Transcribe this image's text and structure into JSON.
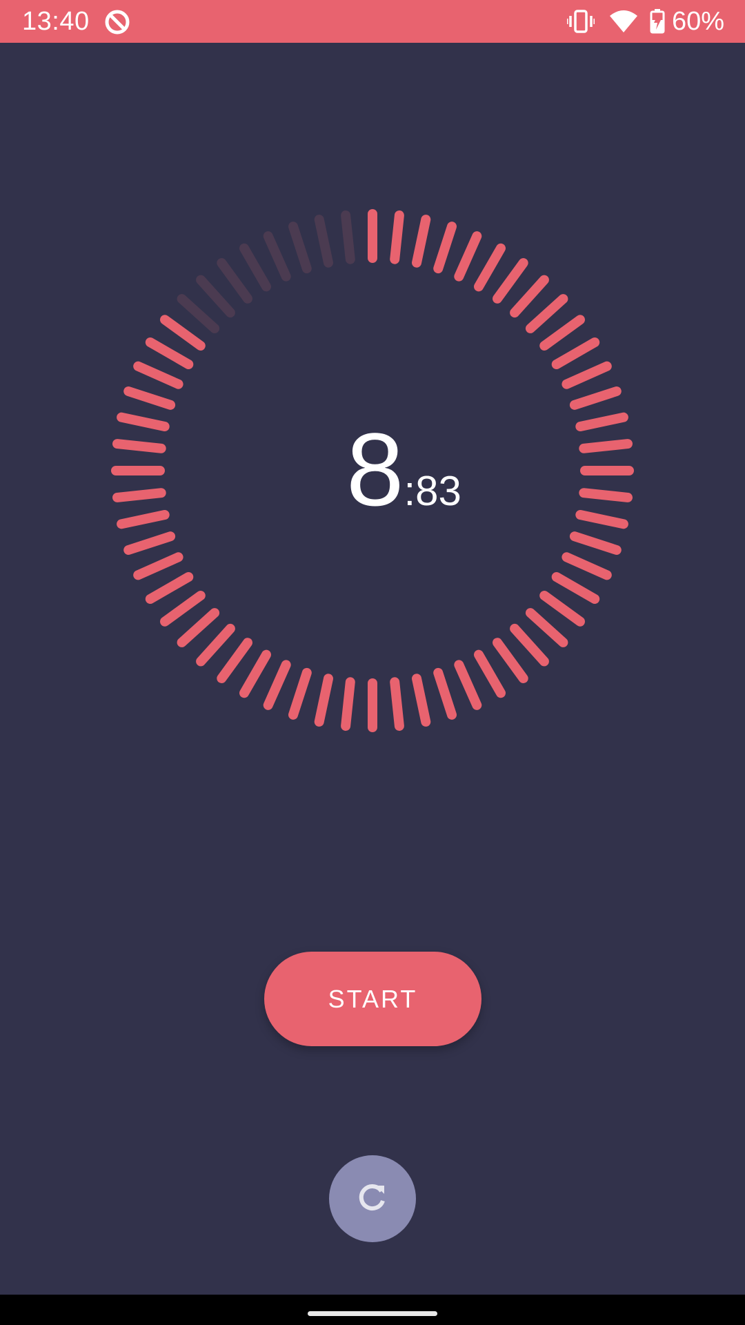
{
  "status_bar": {
    "time": "13:40",
    "battery_percent": "60%",
    "color": "#e8636f",
    "icons": [
      "timer-app-icon",
      "vibrate-icon",
      "wifi-icon",
      "battery-charging-icon"
    ]
  },
  "timer": {
    "seconds": "8",
    "centiseconds": ":83",
    "total_ticks": 60,
    "active_ticks": 52,
    "inactive_ticks": 8,
    "tick_active_color": "#e8636f",
    "tick_inactive_color": "#4b3b51"
  },
  "controls": {
    "start_label": "START",
    "reset_icon": "refresh-icon",
    "accent_color": "#e8636f",
    "reset_color": "#8a8bb2"
  },
  "theme": {
    "background": "#32324b"
  }
}
